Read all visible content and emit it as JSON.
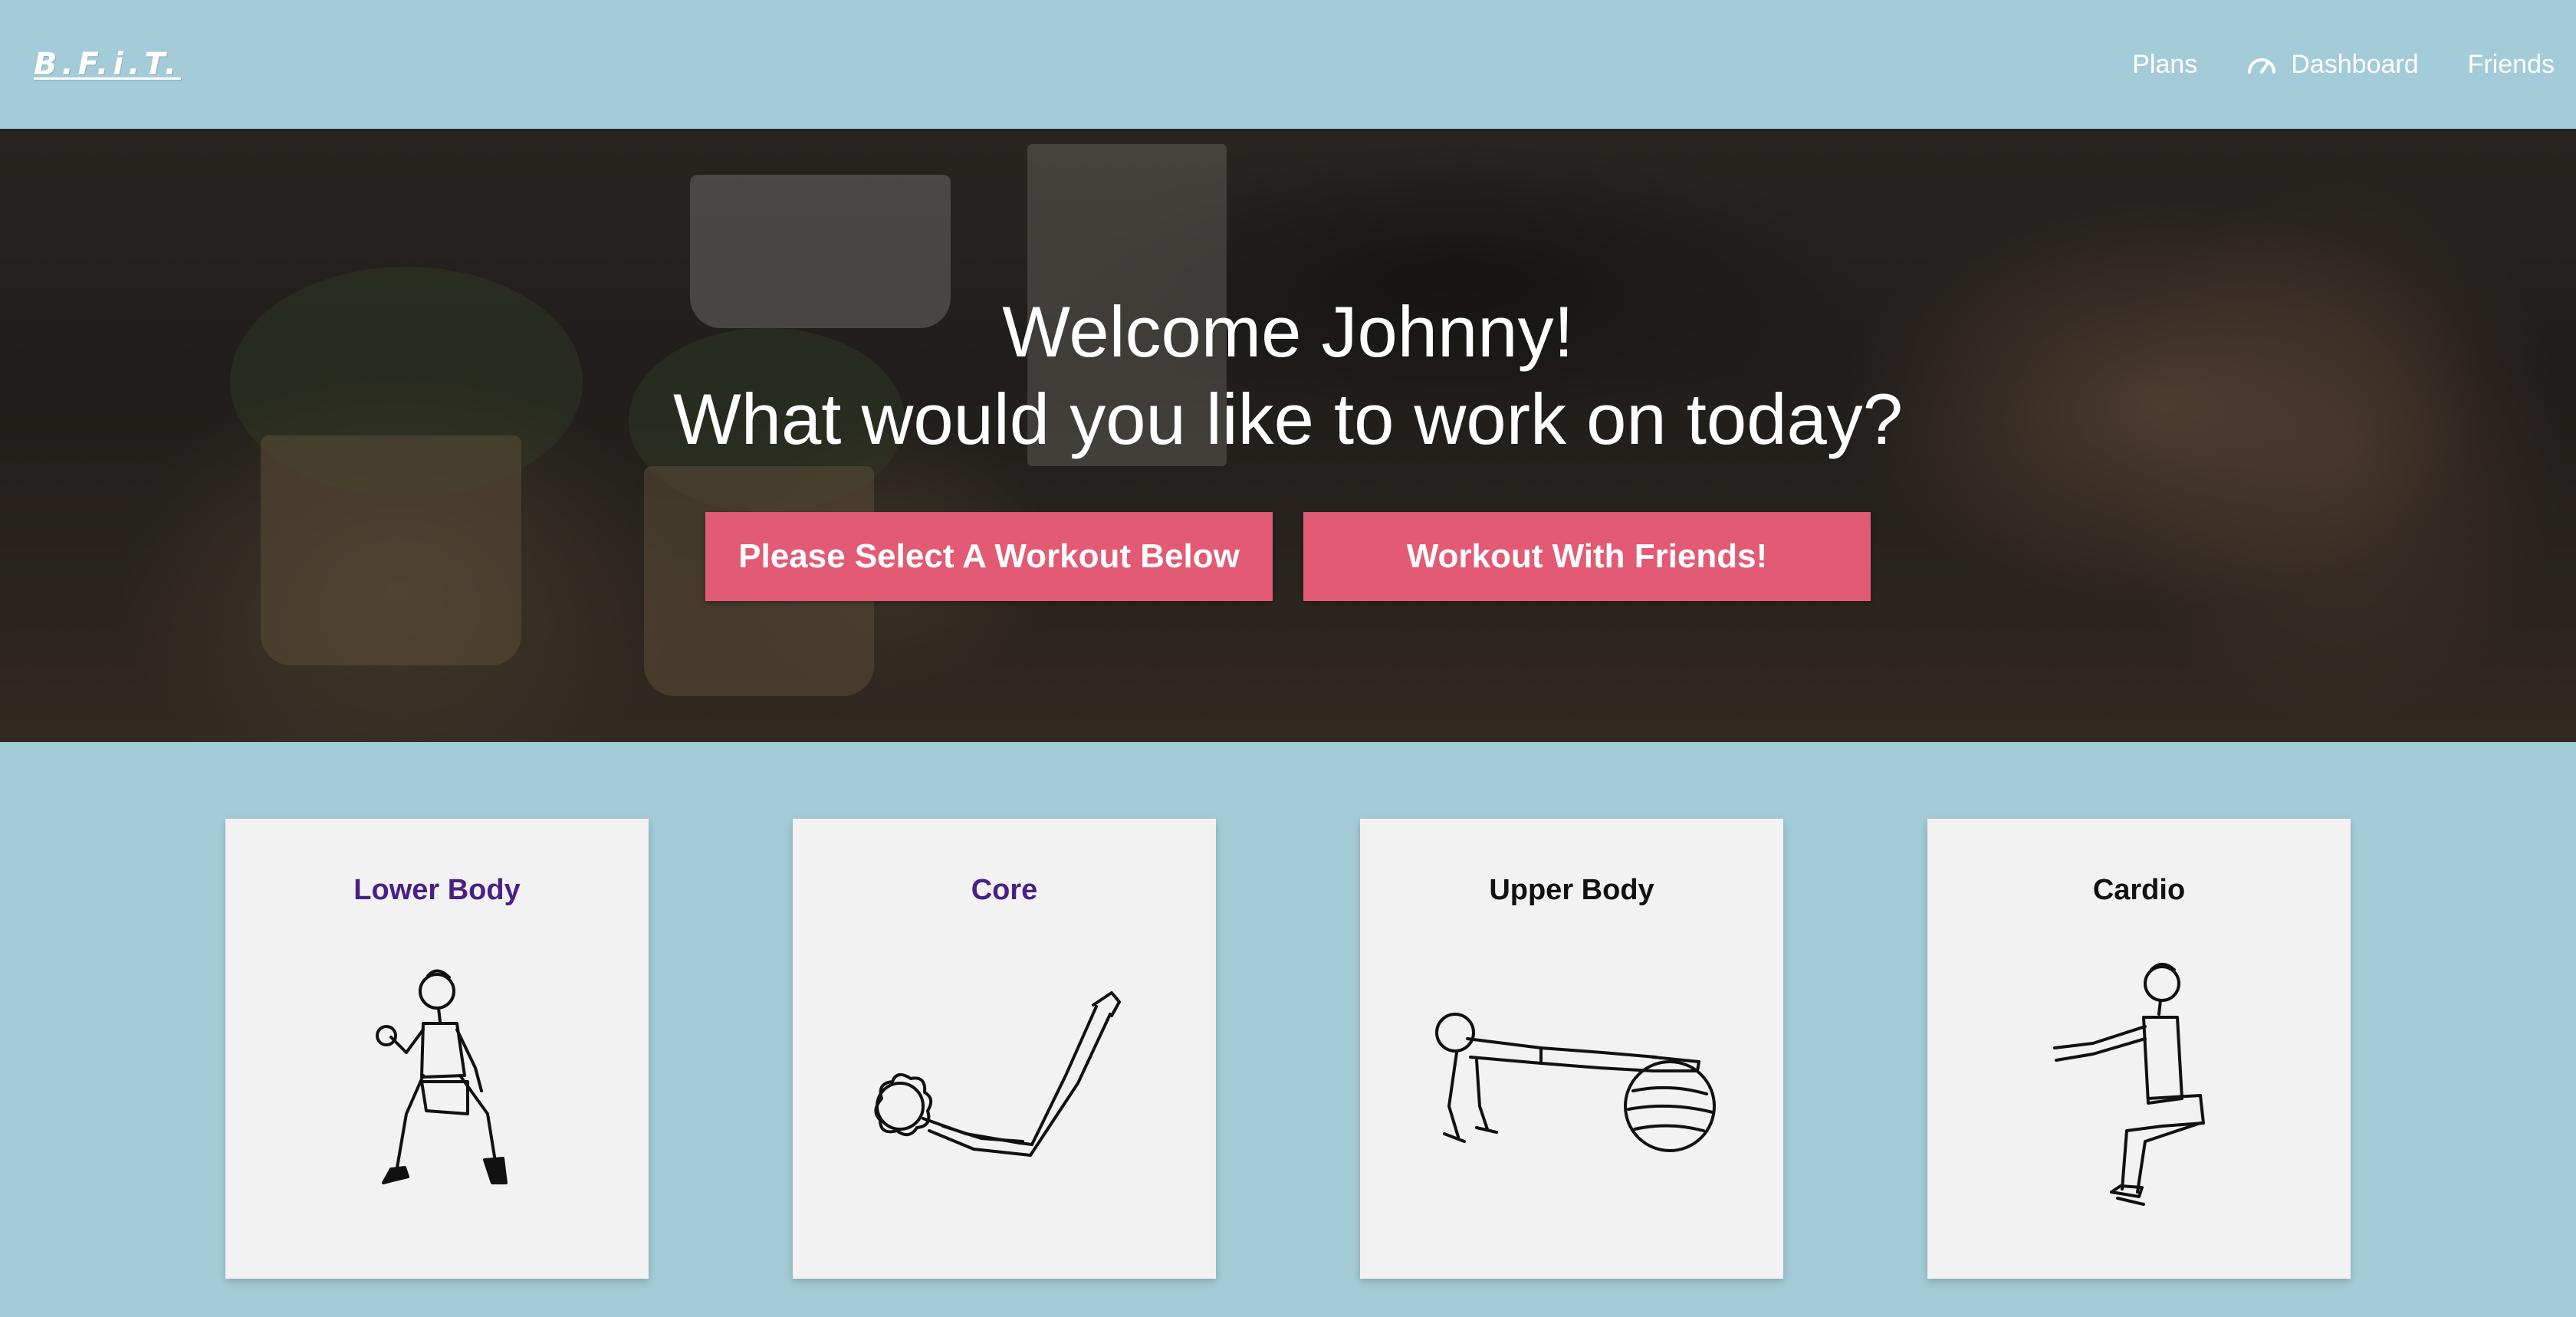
{
  "navbar": {
    "logo": "B.F.i.T.",
    "links": [
      {
        "label": "Plans",
        "icon": null
      },
      {
        "label": "Dashboard",
        "icon": "gauge-icon"
      },
      {
        "label": "Friends",
        "icon": null
      }
    ]
  },
  "hero": {
    "title_line1": "Welcome Johnny!",
    "title_line2": "What would you like to work on today?",
    "buttons": [
      {
        "label": "Please Select A Workout Below"
      },
      {
        "label": "Workout With Friends!"
      }
    ]
  },
  "workouts": [
    {
      "title": "Lower Body",
      "icon": "lunge-figure-icon",
      "visited": true
    },
    {
      "title": "Core",
      "icon": "v-sit-figure-icon",
      "visited": true
    },
    {
      "title": "Upper Body",
      "icon": "plank-ball-figure-icon",
      "visited": false
    },
    {
      "title": "Cardio",
      "icon": "squat-figure-icon",
      "visited": false
    }
  ],
  "colors": {
    "background": "#a4cbd8",
    "button": "#e35a74",
    "card": "#f2f2f2",
    "visited_link": "#4a1f86"
  }
}
